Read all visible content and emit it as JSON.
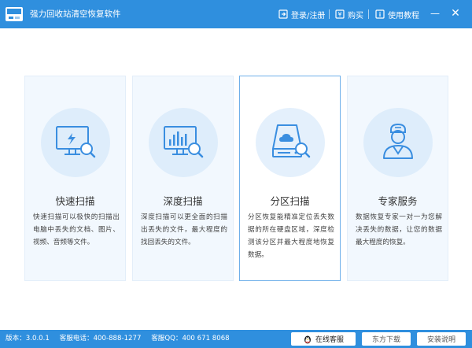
{
  "app": {
    "title": "强力回收站清空恢复软件"
  },
  "toolbar": {
    "login_label": "登录/注册",
    "buy_label": "购买",
    "tutorial_label": "使用教程"
  },
  "cards": [
    {
      "title": "快速扫描",
      "desc": "快速扫描可以极快的扫描出电脑中丢失的文档、图片、视频、音频等文件。",
      "icon": "monitor-lightning-icon"
    },
    {
      "title": "深度扫描",
      "desc": "深度扫描可以更全面的扫描出丢失的文件，最大程度的找回丢失的文件。",
      "icon": "monitor-chart-icon"
    },
    {
      "title": "分区扫描",
      "desc": "分区恢复能精准定位丢失数据的所在硬盘区域，深度检测该分区并最大程度地恢复数据。",
      "icon": "disk-cloud-icon"
    },
    {
      "title": "专家服务",
      "desc": "数据恢复专家一对一为您解决丢失的数据，让您的数据最大程度的恢复。",
      "icon": "expert-person-icon"
    }
  ],
  "footer": {
    "version": "版本：3.0.0.1",
    "phone": "客服电话：400-888-1277",
    "qq": "客服QQ：400 671 8068",
    "online_service": "在线客服",
    "btn2": "东方下载",
    "btn3": "安装说明"
  },
  "colors": {
    "primary": "#2f8fde",
    "card_bg": "#f2f8fe",
    "active_border": "#6fb0ea",
    "icon_blue": "#3a8ee0"
  }
}
